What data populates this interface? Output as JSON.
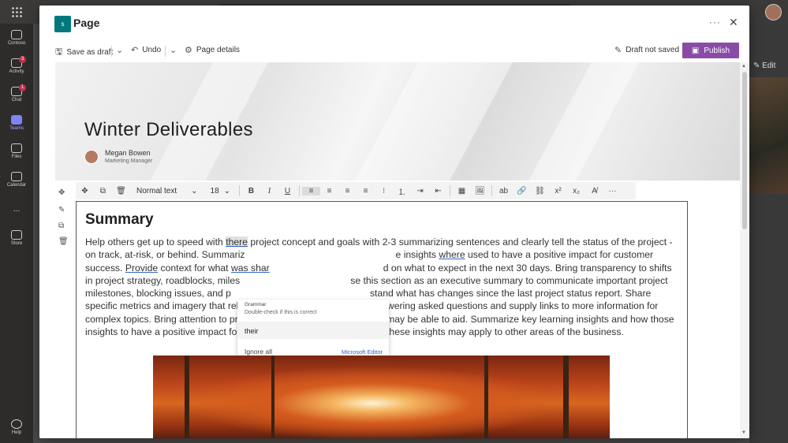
{
  "modal": {
    "title": "Page",
    "app_icon_text": "s"
  },
  "commandbar": {
    "save_draft": "Save as draft",
    "undo": "Undo",
    "page_details": "Page details",
    "status": "Draft not saved",
    "publish": "Publish"
  },
  "page": {
    "title": "Winter Deliverables",
    "author_name": "Megan Bowen",
    "author_role": "Marketing Manager"
  },
  "toolbar": {
    "text_style": "Normal text",
    "font_size": "18"
  },
  "section": {
    "heading": "Summary",
    "body_1": "Help others get up to speed with ",
    "flagged_word": "there",
    "body_2": " project concept and goals with 2-3 summarizing sentences and clearly tell the status of the project - on track, at-risk, or behind. Summariz",
    "body_3": "e insights ",
    "flagged_word_2": "where",
    "body_4": " used to have a positive impact for customer success. ",
    "flagged_word_3": "Provide",
    "body_5": " context for what ",
    "flagged_word_4": "was shar",
    "body_6": "d on what to expect in the next 30 days. Bring transparency to shifts in project strategy, roadblocks, miles",
    "body_7": "se this section as an executive summary to communicate important project milestones, blocking issues, and p",
    "body_8": "stand what has changes since the last project status report. Share specific metrics and imagery that relate to",
    "body_9": "wering asked questions and supply links to more information for complex topics. Bring attention to project challenges and where others may be able to aid. Summarize key learning insights and how those insights to have a positive impact for customer success. Consider how these insights may apply to other areas of the business."
  },
  "suggestion": {
    "category": "Grammar",
    "hint": "Double-check if this is correct",
    "option": "their",
    "ignore": "Ignore all",
    "brand": "Microsoft Editor"
  },
  "teams_rail": [
    {
      "label": "Contoso"
    },
    {
      "label": "Activity",
      "badge": "3"
    },
    {
      "label": "Chat",
      "badge": "1"
    },
    {
      "label": "Teams"
    },
    {
      "label": "Files"
    },
    {
      "label": "Calendar"
    },
    {
      "label": "..."
    },
    {
      "label": "Store"
    },
    {
      "label": "Help"
    }
  ],
  "background": {
    "edit_label": "Edit"
  },
  "colors": {
    "publish": "#8a4ba7",
    "app_icon": "#03787c",
    "teams_accent": "#7f85f5",
    "link": "#3462c4"
  }
}
